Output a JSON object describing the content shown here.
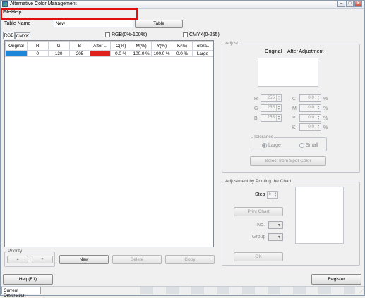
{
  "window": {
    "title": "Alternative Color Management"
  },
  "menu": {
    "file": "File",
    "help": "Help"
  },
  "form": {
    "table_name_label": "Table Name",
    "table_name_value": "New",
    "table_button": "Table"
  },
  "checks": {
    "rgb_percent": "RGB(0%-100%)",
    "cmyk_range": "CMYK(0-255)"
  },
  "tabs": [
    "RGB",
    "CMYK"
  ],
  "table": {
    "headers": [
      "Original",
      "R",
      "G",
      "B",
      "After ...",
      "C(%)",
      "M(%)",
      "Y(%)",
      "K(%)",
      "Tolera..."
    ],
    "rows": [
      {
        "original_color": "#1e86d8",
        "r": "0",
        "g": "130",
        "b": "205",
        "after_color": "#e0201a",
        "c": "0.0 %",
        "m": "100.0 %",
        "y": "100.0 %",
        "k": "0.0 %",
        "tolerance": "Large"
      }
    ]
  },
  "priority": {
    "title": "Priority",
    "up": "▲",
    "down": "▼"
  },
  "list_buttons": {
    "new": "New",
    "delete": "Delete",
    "copy": "Copy"
  },
  "adjust": {
    "title": "Adjust",
    "original_label": "Original",
    "after_label": "After Adjustment",
    "rgb": [
      {
        "label": "R",
        "value": "255"
      },
      {
        "label": "G",
        "value": "255"
      },
      {
        "label": "B",
        "value": "255"
      }
    ],
    "cmyk": [
      {
        "label": "C",
        "value": "0.0",
        "unit": "%"
      },
      {
        "label": "M",
        "value": "0.0",
        "unit": "%"
      },
      {
        "label": "Y",
        "value": "0.0",
        "unit": "%"
      },
      {
        "label": "K",
        "value": "0.0",
        "unit": "%"
      }
    ],
    "tolerance_title": "Tolerance",
    "tolerance_large": "Large",
    "tolerance_small": "Small",
    "spot_button": "Select from Spot Color"
  },
  "chart": {
    "title": "Adjustment by Printing the Chart",
    "step_label": "Step",
    "step_value": "5",
    "print_button": "Print Chart",
    "no_label": "No.",
    "group_label": "Group",
    "ok_button": "OK"
  },
  "footer": {
    "help_button": "Help(F1)",
    "register_button": "Register"
  },
  "status": {
    "current_destination": "Current Destination"
  }
}
